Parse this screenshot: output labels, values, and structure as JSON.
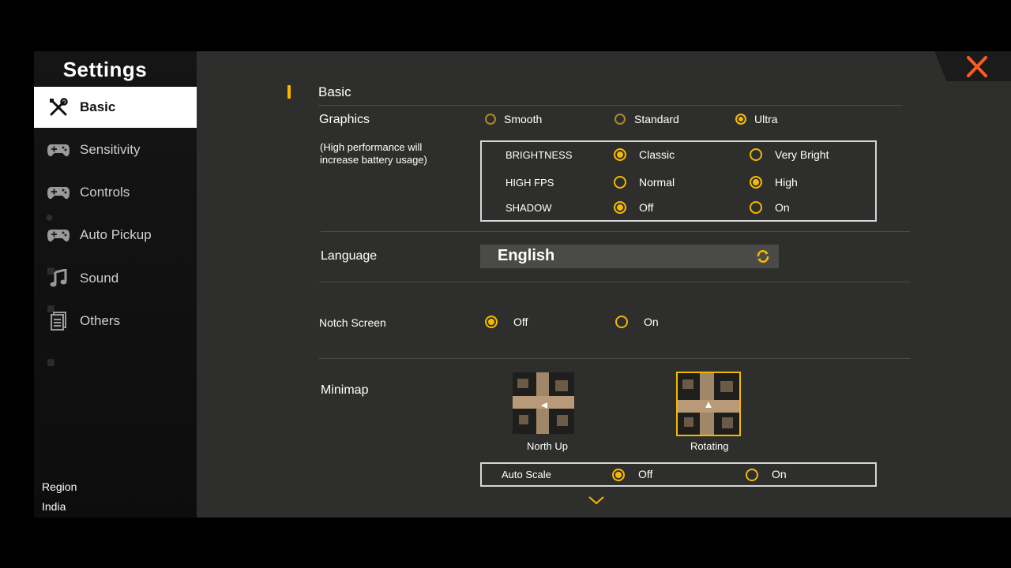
{
  "sidebar": {
    "title": "Settings",
    "items": [
      {
        "label": "Basic",
        "icon": "wrench-screwdriver-icon",
        "active": true
      },
      {
        "label": "Sensitivity",
        "icon": "gamepad-icon",
        "active": false
      },
      {
        "label": "Controls",
        "icon": "gamepad-icon",
        "active": false
      },
      {
        "label": "Auto Pickup",
        "icon": "gamepad-icon",
        "active": false
      },
      {
        "label": "Sound",
        "icon": "music-note-icon",
        "active": false
      },
      {
        "label": "Others",
        "icon": "document-list-icon",
        "active": false
      }
    ],
    "region_label": "Region",
    "region_value": "India"
  },
  "main": {
    "section_title": "Basic",
    "graphics": {
      "label": "Graphics",
      "note": "(High performance will increase battery usage)",
      "options": [
        "Smooth",
        "Standard",
        "Ultra"
      ],
      "selected": "Ultra",
      "sub": [
        {
          "label": "BRIGHTNESS",
          "options": [
            "Classic",
            "Very Bright"
          ],
          "selected": "Classic"
        },
        {
          "label": "HIGH FPS",
          "options": [
            "Normal",
            "High"
          ],
          "selected": "High"
        },
        {
          "label": "SHADOW",
          "options": [
            "Off",
            "On"
          ],
          "selected": "Off"
        }
      ]
    },
    "language": {
      "label": "Language",
      "value": "English"
    },
    "notch_screen": {
      "label": "Notch Screen",
      "options": [
        "Off",
        "On"
      ],
      "selected": "Off"
    },
    "minimap": {
      "label": "Minimap",
      "options": [
        "North Up",
        "Rotating"
      ],
      "selected": "Rotating",
      "auto_scale": {
        "label": "Auto Scale",
        "options": [
          "Off",
          "On"
        ],
        "selected": "Off"
      }
    }
  },
  "colors": {
    "accent": "#f6b900",
    "close": "#ff5a1f",
    "panel": "#2e2f2c"
  }
}
